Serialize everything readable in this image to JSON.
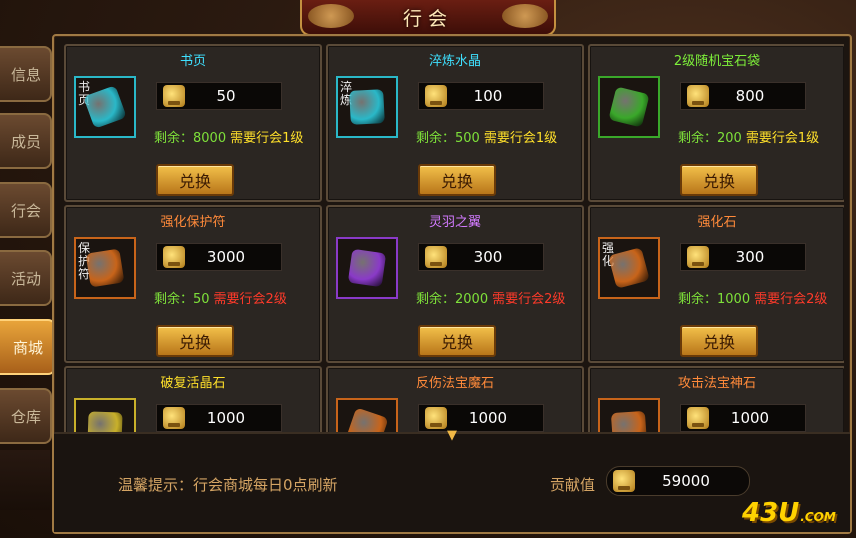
{
  "title": "行会",
  "tabs": [
    {
      "label": "信息",
      "active": false
    },
    {
      "label": "成员",
      "active": false
    },
    {
      "label": "行会",
      "active": false
    },
    {
      "label": "活动",
      "active": false
    },
    {
      "label": "商城",
      "active": true
    },
    {
      "label": "仓库",
      "active": false
    }
  ],
  "items": [
    {
      "name": "书页",
      "name_color": "#3fe0ff",
      "icon": "book-page-icon",
      "icon_tag": "书页",
      "border": "#2ab8c8",
      "price": "50",
      "remain": "剩余：8000",
      "requirement": "需要行会1级",
      "req_color": "#ffe02a",
      "button": "兑换"
    },
    {
      "name": "淬炼水晶",
      "name_color": "#3fe0ff",
      "icon": "purple-crystal-icon",
      "icon_tag": "淬炼",
      "border": "#2ab8c8",
      "price": "100",
      "remain": "剩余：500",
      "requirement": "需要行会1级",
      "req_color": "#ffe02a",
      "button": "兑换"
    },
    {
      "name": "2级随机宝石袋",
      "name_color": "#7ef03a",
      "icon": "gem-bag-icon",
      "icon_tag": "",
      "border": "#3aa82a",
      "price": "800",
      "remain": "剩余：200",
      "requirement": "需要行会1级",
      "req_color": "#ffe02a",
      "button": "兑换"
    },
    {
      "name": "强化保护符",
      "name_color": "#ff8a3a",
      "icon": "protect-charm-icon",
      "icon_tag": "保护符",
      "border": "#c8641a",
      "price": "3000",
      "remain": "剩余：50",
      "requirement": "需要行会2级",
      "req_color": "#ff3a2a",
      "button": "兑换"
    },
    {
      "name": "灵羽之翼",
      "name_color": "#d27aff",
      "icon": "feather-wing-icon",
      "icon_tag": "",
      "border": "#8a3ac8",
      "price": "300",
      "remain": "剩余：2000",
      "requirement": "需要行会2级",
      "req_color": "#ff3a2a",
      "button": "兑换"
    },
    {
      "name": "强化石",
      "name_color": "#ff8a3a",
      "icon": "blue-stone-icon",
      "icon_tag": "强化",
      "border": "#c8641a",
      "price": "300",
      "remain": "剩余：1000",
      "requirement": "需要行会2级",
      "req_color": "#ff3a2a",
      "button": "兑换"
    },
    {
      "name": "破复活晶石",
      "name_color": "#ffe02a",
      "icon": "purple-gem-icon",
      "icon_tag": "",
      "border": "#c8b02a",
      "price": "1000",
      "remain": "",
      "requirement": "",
      "req_color": "#ffe02a",
      "button": ""
    },
    {
      "name": "反伤法宝魔石",
      "name_color": "#ff8a3a",
      "icon": "magic-stone-icon",
      "icon_tag": "",
      "border": "#c8641a",
      "price": "1000",
      "remain": "",
      "requirement": "",
      "req_color": "#ff3a2a",
      "button": ""
    },
    {
      "name": "攻击法宝神石",
      "name_color": "#ff8a3a",
      "icon": "attack-stone-icon",
      "icon_tag": "",
      "border": "#c8641a",
      "price": "1000",
      "remain": "",
      "requirement": "",
      "req_color": "#ff3a2a",
      "button": ""
    }
  ],
  "footer": {
    "tip": "温馨提示：行会商城每日0点刷新",
    "contribution_label": "贡献值",
    "contribution_value": "59000"
  },
  "watermark": {
    "main": "43U",
    "suffix": ".COM"
  }
}
